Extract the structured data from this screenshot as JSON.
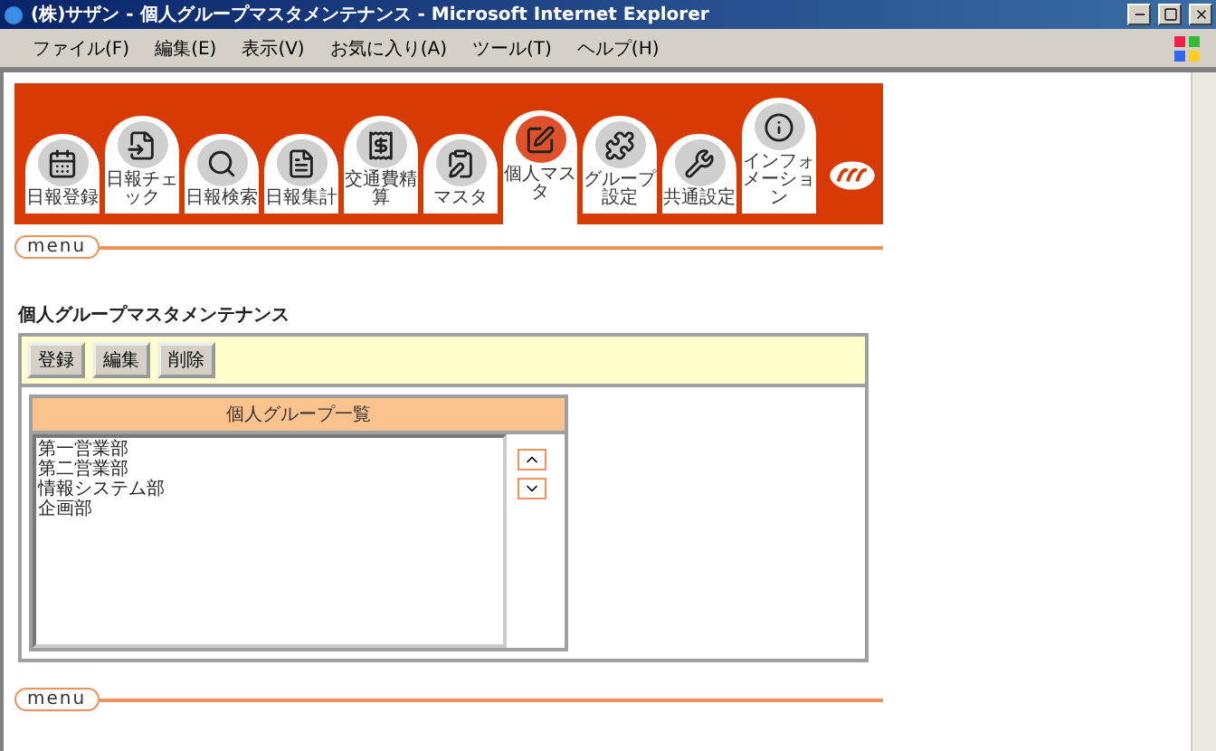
{
  "window": {
    "title": "(株)サザン - 個人グループマスタメンテナンス - Microsoft Internet Explorer"
  },
  "menu_bar": [
    "ファイル(F)",
    "編集(E)",
    "表示(V)",
    "お気に入り(A)",
    "ツール(T)",
    "ヘルプ(H)"
  ],
  "tabs": [
    {
      "label": "日報登録",
      "selected": false
    },
    {
      "label": "日報チェック",
      "selected": false
    },
    {
      "label": "日報検索",
      "selected": false
    },
    {
      "label": "日報集計",
      "selected": false
    },
    {
      "label": "交通費精算",
      "selected": false
    },
    {
      "label": "マスタ",
      "selected": false
    },
    {
      "label": "個人マスタ",
      "selected": true
    },
    {
      "label": "グループ設定",
      "selected": false
    },
    {
      "label": "共通設定",
      "selected": false
    },
    {
      "label": "インフォメーション",
      "selected": false
    }
  ],
  "menu_label_top": "menu",
  "page_title": "個人グループマスタメンテナンス",
  "toolbar_buttons": [
    "登録",
    "編集",
    "削除"
  ],
  "list": {
    "header": "個人グループ一覧",
    "items": [
      {
        "label": "第一営業部",
        "selected": false
      },
      {
        "label": "第二営業部",
        "selected": false
      },
      {
        "label": "情報システム部",
        "selected": false
      },
      {
        "label": "企画部",
        "selected": false
      }
    ]
  },
  "menu_label_bottom": "menu"
}
